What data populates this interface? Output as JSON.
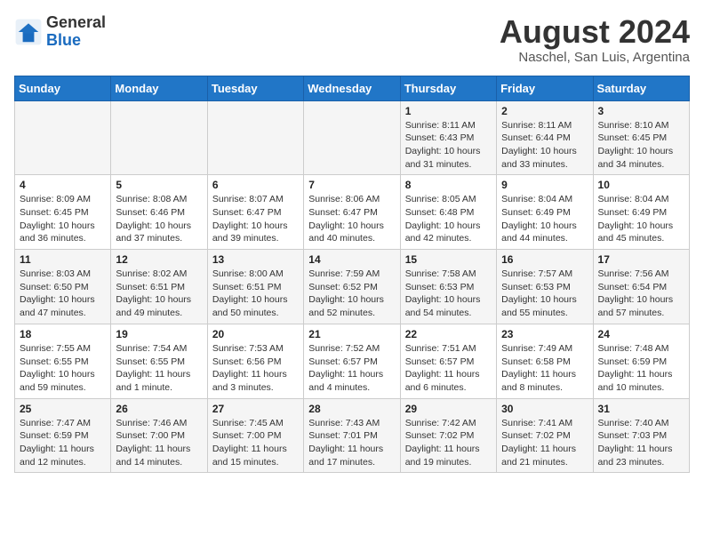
{
  "header": {
    "logo_general": "General",
    "logo_blue": "Blue",
    "month_title": "August 2024",
    "location": "Naschel, San Luis, Argentina"
  },
  "weekdays": [
    "Sunday",
    "Monday",
    "Tuesday",
    "Wednesday",
    "Thursday",
    "Friday",
    "Saturday"
  ],
  "weeks": [
    [
      {
        "day": "",
        "info": ""
      },
      {
        "day": "",
        "info": ""
      },
      {
        "day": "",
        "info": ""
      },
      {
        "day": "",
        "info": ""
      },
      {
        "day": "1",
        "info": "Sunrise: 8:11 AM\nSunset: 6:43 PM\nDaylight: 10 hours\nand 31 minutes."
      },
      {
        "day": "2",
        "info": "Sunrise: 8:11 AM\nSunset: 6:44 PM\nDaylight: 10 hours\nand 33 minutes."
      },
      {
        "day": "3",
        "info": "Sunrise: 8:10 AM\nSunset: 6:45 PM\nDaylight: 10 hours\nand 34 minutes."
      }
    ],
    [
      {
        "day": "4",
        "info": "Sunrise: 8:09 AM\nSunset: 6:45 PM\nDaylight: 10 hours\nand 36 minutes."
      },
      {
        "day": "5",
        "info": "Sunrise: 8:08 AM\nSunset: 6:46 PM\nDaylight: 10 hours\nand 37 minutes."
      },
      {
        "day": "6",
        "info": "Sunrise: 8:07 AM\nSunset: 6:47 PM\nDaylight: 10 hours\nand 39 minutes."
      },
      {
        "day": "7",
        "info": "Sunrise: 8:06 AM\nSunset: 6:47 PM\nDaylight: 10 hours\nand 40 minutes."
      },
      {
        "day": "8",
        "info": "Sunrise: 8:05 AM\nSunset: 6:48 PM\nDaylight: 10 hours\nand 42 minutes."
      },
      {
        "day": "9",
        "info": "Sunrise: 8:04 AM\nSunset: 6:49 PM\nDaylight: 10 hours\nand 44 minutes."
      },
      {
        "day": "10",
        "info": "Sunrise: 8:04 AM\nSunset: 6:49 PM\nDaylight: 10 hours\nand 45 minutes."
      }
    ],
    [
      {
        "day": "11",
        "info": "Sunrise: 8:03 AM\nSunset: 6:50 PM\nDaylight: 10 hours\nand 47 minutes."
      },
      {
        "day": "12",
        "info": "Sunrise: 8:02 AM\nSunset: 6:51 PM\nDaylight: 10 hours\nand 49 minutes."
      },
      {
        "day": "13",
        "info": "Sunrise: 8:00 AM\nSunset: 6:51 PM\nDaylight: 10 hours\nand 50 minutes."
      },
      {
        "day": "14",
        "info": "Sunrise: 7:59 AM\nSunset: 6:52 PM\nDaylight: 10 hours\nand 52 minutes."
      },
      {
        "day": "15",
        "info": "Sunrise: 7:58 AM\nSunset: 6:53 PM\nDaylight: 10 hours\nand 54 minutes."
      },
      {
        "day": "16",
        "info": "Sunrise: 7:57 AM\nSunset: 6:53 PM\nDaylight: 10 hours\nand 55 minutes."
      },
      {
        "day": "17",
        "info": "Sunrise: 7:56 AM\nSunset: 6:54 PM\nDaylight: 10 hours\nand 57 minutes."
      }
    ],
    [
      {
        "day": "18",
        "info": "Sunrise: 7:55 AM\nSunset: 6:55 PM\nDaylight: 10 hours\nand 59 minutes."
      },
      {
        "day": "19",
        "info": "Sunrise: 7:54 AM\nSunset: 6:55 PM\nDaylight: 11 hours\nand 1 minute."
      },
      {
        "day": "20",
        "info": "Sunrise: 7:53 AM\nSunset: 6:56 PM\nDaylight: 11 hours\nand 3 minutes."
      },
      {
        "day": "21",
        "info": "Sunrise: 7:52 AM\nSunset: 6:57 PM\nDaylight: 11 hours\nand 4 minutes."
      },
      {
        "day": "22",
        "info": "Sunrise: 7:51 AM\nSunset: 6:57 PM\nDaylight: 11 hours\nand 6 minutes."
      },
      {
        "day": "23",
        "info": "Sunrise: 7:49 AM\nSunset: 6:58 PM\nDaylight: 11 hours\nand 8 minutes."
      },
      {
        "day": "24",
        "info": "Sunrise: 7:48 AM\nSunset: 6:59 PM\nDaylight: 11 hours\nand 10 minutes."
      }
    ],
    [
      {
        "day": "25",
        "info": "Sunrise: 7:47 AM\nSunset: 6:59 PM\nDaylight: 11 hours\nand 12 minutes."
      },
      {
        "day": "26",
        "info": "Sunrise: 7:46 AM\nSunset: 7:00 PM\nDaylight: 11 hours\nand 14 minutes."
      },
      {
        "day": "27",
        "info": "Sunrise: 7:45 AM\nSunset: 7:00 PM\nDaylight: 11 hours\nand 15 minutes."
      },
      {
        "day": "28",
        "info": "Sunrise: 7:43 AM\nSunset: 7:01 PM\nDaylight: 11 hours\nand 17 minutes."
      },
      {
        "day": "29",
        "info": "Sunrise: 7:42 AM\nSunset: 7:02 PM\nDaylight: 11 hours\nand 19 minutes."
      },
      {
        "day": "30",
        "info": "Sunrise: 7:41 AM\nSunset: 7:02 PM\nDaylight: 11 hours\nand 21 minutes."
      },
      {
        "day": "31",
        "info": "Sunrise: 7:40 AM\nSunset: 7:03 PM\nDaylight: 11 hours\nand 23 minutes."
      }
    ]
  ]
}
